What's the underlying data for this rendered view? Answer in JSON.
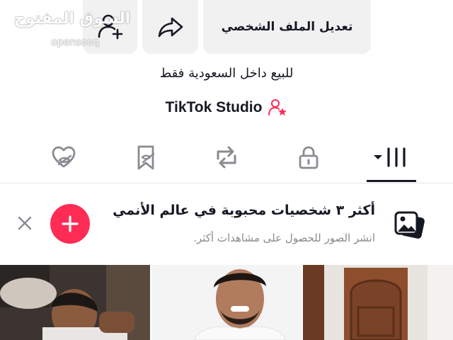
{
  "header": {
    "edit_profile_label": "تعديل الملف الشخصي",
    "share_icon": "share-arrow-icon",
    "add_friend_icon": "add-friend-icon"
  },
  "watermark": {
    "main": "السوق المفتوح",
    "sub": "opensooq"
  },
  "profile": {
    "bio": "للبيع داخل السعودية فقط",
    "studio_label": "TikTok Studio",
    "studio_icon": "creator-star-icon"
  },
  "tabs": [
    {
      "name": "videos",
      "icon": "grid-bars-icon",
      "active": true
    },
    {
      "name": "private",
      "icon": "lock-icon",
      "active": false
    },
    {
      "name": "reposts",
      "icon": "repost-icon",
      "active": false
    },
    {
      "name": "favorites",
      "icon": "bookmark-hidden-icon",
      "active": false
    },
    {
      "name": "liked",
      "icon": "heart-hidden-icon",
      "active": false
    }
  ],
  "promo": {
    "title": "أكثر ٣ شخصيات محبوبة في عالم الأنمي",
    "subtitle": "انشر الصور للحصول على مشاهدات أكثر.",
    "icon": "photo-stack-icon",
    "action_icon": "plus-icon",
    "close_icon": "close-icon"
  },
  "colors": {
    "accent": "#fe2c55",
    "text_primary": "#161823",
    "text_secondary": "#8a8b91",
    "button_bg": "#f1f1f2"
  },
  "thumbnails": [
    {
      "name": "video-thumb-1"
    },
    {
      "name": "video-thumb-2"
    },
    {
      "name": "video-thumb-3"
    }
  ]
}
